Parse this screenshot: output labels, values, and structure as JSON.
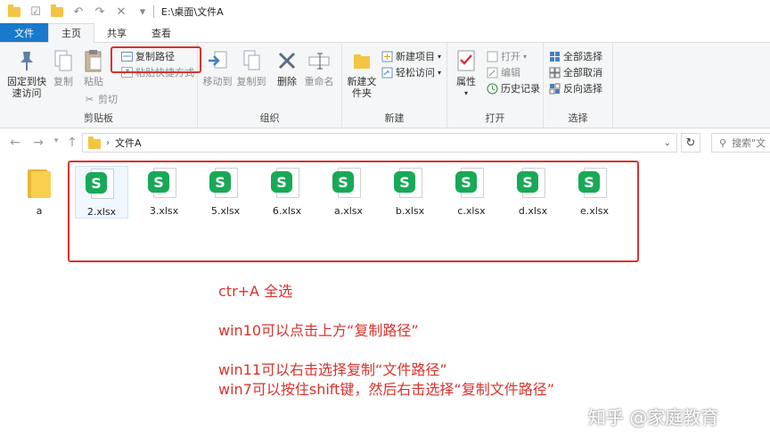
{
  "window": {
    "title": "E:\\桌面\\文件A"
  },
  "tabs": {
    "file": "文件",
    "home": "主页",
    "share": "共享",
    "view": "查看"
  },
  "ribbon": {
    "clipboard": {
      "label": "剪贴板",
      "pin": "固定到快速访问",
      "copy": "复制",
      "paste": "粘贴",
      "copy_path": "复制路径",
      "paste_shortcut": "粘贴快捷方式",
      "cut": "剪切"
    },
    "organize": {
      "label": "组织",
      "move_to": "移动到",
      "copy_to": "复制到",
      "delete": "删除",
      "rename": "重命名"
    },
    "new": {
      "label": "新建",
      "new_folder": "新建文件夹",
      "new_item": "新建项目",
      "easy_access": "轻松访问"
    },
    "open": {
      "label": "打开",
      "properties": "属性",
      "open": "打开",
      "edit": "编辑",
      "history": "历史记录"
    },
    "select": {
      "label": "选择",
      "select_all": "全部选择",
      "select_none": "全部取消",
      "invert": "反向选择"
    }
  },
  "address": {
    "folder": "文件A",
    "search_placeholder": "搜索\"文"
  },
  "files": [
    {
      "name": "a",
      "type": "folder"
    },
    {
      "name": "2.xlsx",
      "type": "xlsx"
    },
    {
      "name": "3.xlsx",
      "type": "xlsx"
    },
    {
      "name": "5.xlsx",
      "type": "xlsx"
    },
    {
      "name": "6.xlsx",
      "type": "xlsx"
    },
    {
      "name": "a.xlsx",
      "type": "xlsx"
    },
    {
      "name": "b.xlsx",
      "type": "xlsx"
    },
    {
      "name": "c.xlsx",
      "type": "xlsx"
    },
    {
      "name": "d.xlsx",
      "type": "xlsx"
    },
    {
      "name": "e.xlsx",
      "type": "xlsx"
    }
  ],
  "notes": [
    "ctr+A 全选",
    "",
    "win10可以点击上方“复制路径”",
    "",
    "win11可以右击选择复制“文件路径”",
    "win7可以按住shift键，然后右击选择“复制文件路径”"
  ],
  "watermark": "知乎 @家庭教育",
  "colors": {
    "annotation": "#d9322d",
    "file_tab": "#1979ca",
    "xlsx_badge": "#18a957"
  }
}
